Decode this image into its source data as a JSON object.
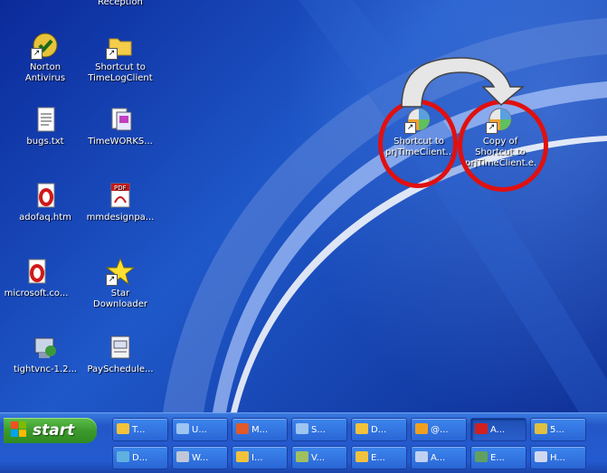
{
  "desktop": {
    "icons": [
      {
        "label": "Reception",
        "icon": "folder-icon"
      },
      {
        "label": "Norton Antivirus",
        "icon": "norton-icon"
      },
      {
        "label": "Shortcut to TimeLogClient",
        "icon": "folder-shortcut-icon"
      },
      {
        "label": "bugs.txt",
        "icon": "text-file-icon"
      },
      {
        "label": "TimeWORKS...",
        "icon": "document-icon"
      },
      {
        "label": "adofaq.htm",
        "icon": "opera-html-icon"
      },
      {
        "label": "mmdesignpa...",
        "icon": "pdf-icon"
      },
      {
        "label": "microsoft.co...",
        "icon": "opera-html-icon"
      },
      {
        "label": "Star Downloader",
        "icon": "star-icon"
      },
      {
        "label": "tightvnc-1.2...",
        "icon": "installer-icon"
      },
      {
        "label": "PaySchedule...",
        "icon": "document-icon"
      },
      {
        "label": "Shortcut to prjTimeClient...",
        "icon": "app-shortcut-icon"
      },
      {
        "label": "Copy of Shortcut to prjTimeClient.e...",
        "icon": "app-shortcut-icon"
      }
    ],
    "annotation_color": "#e01010",
    "arrow_icon": "curved-arrow-icon"
  },
  "taskbar": {
    "start_label": "start",
    "row1": [
      {
        "label": "T...",
        "icon": "folder-icon",
        "color": "#f3c23c",
        "active": false
      },
      {
        "label": "U...",
        "icon": "document-icon",
        "color": "#9ec5f0",
        "active": false
      },
      {
        "label": "M...",
        "icon": "presentation-icon",
        "color": "#e05a2a",
        "active": false
      },
      {
        "label": "S...",
        "icon": "document-icon",
        "color": "#9ec5f0",
        "active": false
      },
      {
        "label": "D...",
        "icon": "folder-icon",
        "color": "#f3c23c",
        "active": false
      },
      {
        "label": "@...",
        "icon": "clock-icon",
        "color": "#f0a020",
        "active": false
      },
      {
        "label": "A...",
        "icon": "pdf-icon",
        "color": "#d02020",
        "active": true
      },
      {
        "label": "5...",
        "icon": "plugin-icon",
        "color": "#e0c040",
        "active": false
      }
    ],
    "row2": [
      {
        "label": "D...",
        "icon": "tool-icon",
        "color": "#60b0e0"
      },
      {
        "label": "W...",
        "icon": "computer-icon",
        "color": "#c0c8d8"
      },
      {
        "label": "I...",
        "icon": "folder-icon",
        "color": "#f3c23c"
      },
      {
        "label": "V...",
        "icon": "editor-icon",
        "color": "#a0c060"
      },
      {
        "label": "E...",
        "icon": "folder-icon",
        "color": "#f3c23c"
      },
      {
        "label": "A...",
        "icon": "network-icon",
        "color": "#c0d0f0"
      },
      {
        "label": "E...",
        "icon": "spreadsheet-icon",
        "color": "#60a060"
      },
      {
        "label": "H...",
        "icon": "window-icon",
        "color": "#d0d8f0"
      }
    ]
  }
}
